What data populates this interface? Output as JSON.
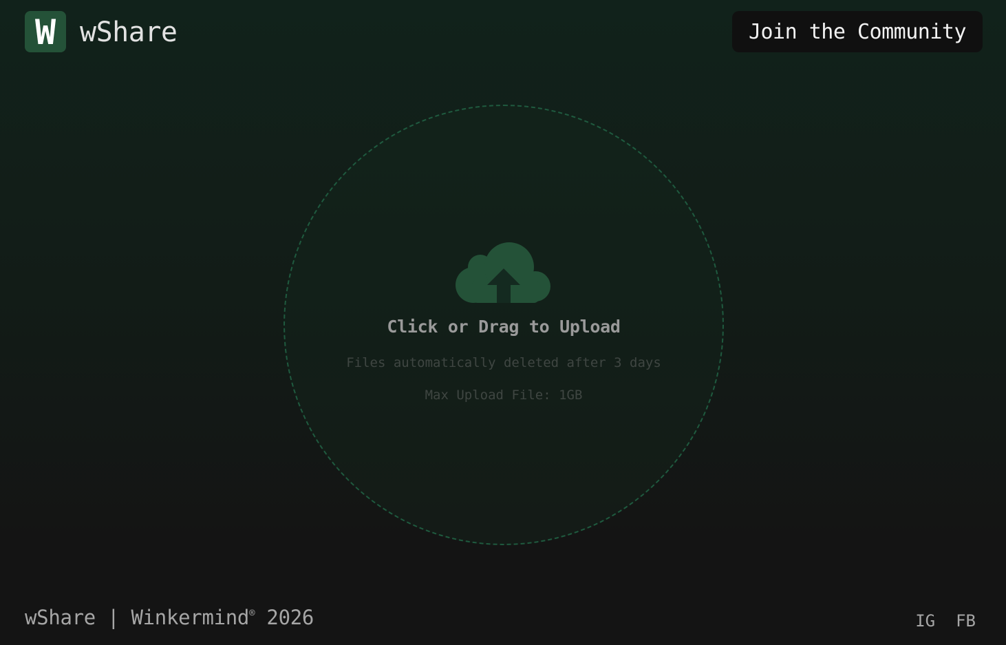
{
  "header": {
    "logo_letter": "W",
    "brand_name": "wShare",
    "community_button_label": "Join the Community"
  },
  "upload": {
    "title": "Click or Drag to Upload",
    "note": "Files automatically deleted after 3 days",
    "max_size": "Max Upload File: 1GB",
    "icon": "cloud-upload-icon"
  },
  "footer": {
    "brand": "wShare",
    "separator": "|",
    "company": "Winkermind",
    "registered_mark": "®",
    "year": "2026",
    "links": [
      {
        "label": "IG"
      },
      {
        "label": "FB"
      }
    ]
  },
  "colors": {
    "accent": "#245238",
    "circle_border": "#1f5a3f",
    "background_top": "#11221b",
    "background_bottom": "#141414"
  }
}
